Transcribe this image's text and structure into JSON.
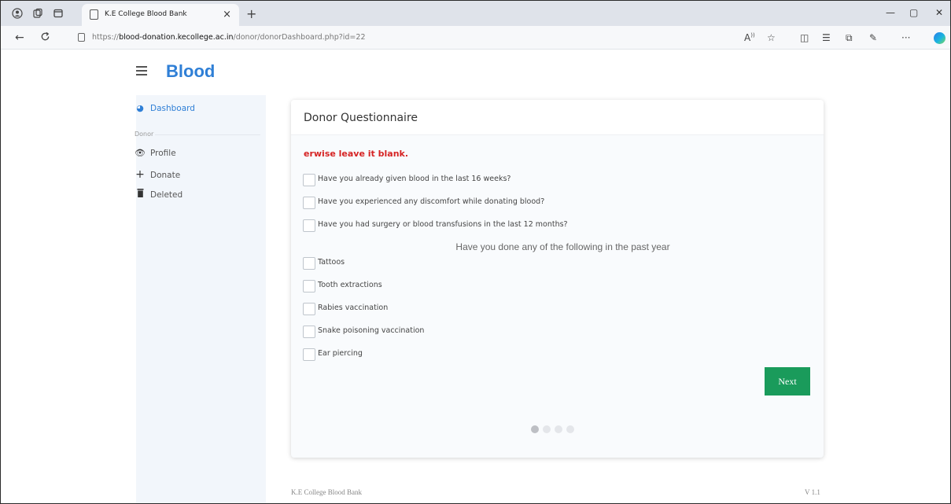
{
  "browser": {
    "tab_title": "K.E College Blood Bank",
    "tab_close": "×",
    "new_tab": "+",
    "url_prefix": "https://",
    "url_host": "blood-donation.kecollege.ac.in",
    "url_path": "/donor/donorDashboard.php?id=22",
    "tab_icons": [
      "profile-icon",
      "workspaces-icon",
      "tab-actions-icon"
    ],
    "toolbar_icons": [
      "read-aloud-icon",
      "favorite-icon",
      "split-screen-icon",
      "favorites-list-icon",
      "collections-icon",
      "extensions-icon",
      "more-icon",
      "copilot-icon"
    ]
  },
  "app": {
    "brand": "Blood",
    "sidebar": {
      "dashboard": "Dashboard",
      "section_label": "Donor",
      "items": [
        {
          "label": "Profile",
          "icon": "eye-icon"
        },
        {
          "label": "Donate",
          "icon": "plus-icon"
        },
        {
          "label": "Deleted",
          "icon": "trash-icon"
        }
      ]
    },
    "accent_color": "#2f7fd6"
  },
  "questionnaire": {
    "title": "Donor Questionnaire",
    "notice": "erwise leave it blank.",
    "questions": [
      "Have you already given blood in the last 16 weeks?",
      "Have you experienced any discomfort while donating blood?",
      "Have you had surgery or blood transfusions in the last 12 months?"
    ],
    "subheading": "Have you done any of the following in the past year",
    "past_year_items": [
      "Tattoos",
      "Tooth extractions",
      "Rabies vaccination",
      "Snake poisoning vaccination",
      "Ear piercing"
    ],
    "next_label": "Next",
    "next_color": "#1a9b5b",
    "notice_color": "#d62424",
    "steps_total": 4,
    "step_current": 1
  },
  "footer": {
    "left": "K.E College Blood Bank",
    "right": "V 1.1"
  }
}
